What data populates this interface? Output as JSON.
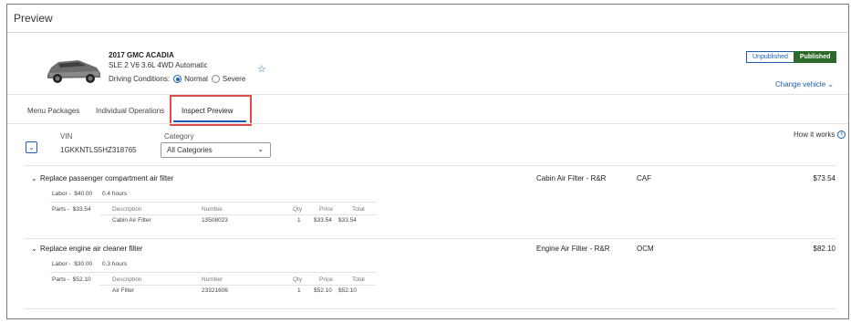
{
  "page": {
    "title": "Preview"
  },
  "vehicle": {
    "title": "2017 GMC ACADIA",
    "subtitle": "SLE 2 V6 3.6L 4WD Automatic",
    "driving_label": "Driving Conditions:",
    "normal": "Normal",
    "severe": "Severe",
    "selected_condition": "Normal"
  },
  "publish": {
    "unpublished": "Unpublished",
    "published": "Published",
    "active": "Published"
  },
  "change_vehicle": "Change vehicle",
  "tabs": [
    {
      "label": "Menu Packages"
    },
    {
      "label": "Individual Operations"
    },
    {
      "label": "Inspect Preview",
      "active": true
    }
  ],
  "vin": {
    "label": "VIN",
    "value": "1GKKNTLS5HZ318765"
  },
  "category": {
    "label": "Category",
    "value": "All Categories"
  },
  "how_it_works": "How it works",
  "parts_headers": {
    "description": "Description",
    "number": "Number",
    "qty": "Qty",
    "price": "Price",
    "total": "Total"
  },
  "services": [
    {
      "name": "Replace passenger compartment air filter",
      "operation": "Cabin Air Filter - R&R",
      "code": "CAF",
      "price": "$73.54",
      "labor_label": "Labor -",
      "labor_amount": "$40.00",
      "labor_hours": "0.4 hours",
      "parts_label": "Parts -",
      "parts_amount": "$33.54",
      "parts": [
        {
          "description": "Cabin Air Filter",
          "number": "13508023",
          "qty": "1",
          "price": "$33.54",
          "total": "$33.54"
        }
      ]
    },
    {
      "name": "Replace engine air cleaner filter",
      "operation": "Engine Air Filter - R&R",
      "code": "OCM",
      "price": "$82.10",
      "labor_label": "Labor -",
      "labor_amount": "$30.00",
      "labor_hours": "0.3 hours",
      "parts_label": "Parts -",
      "parts_amount": "$52.10",
      "parts": [
        {
          "description": "Air Filter",
          "number": "23321606",
          "qty": "1",
          "price": "$52.10",
          "total": "$52.10"
        }
      ]
    }
  ],
  "colors": {
    "accent": "#1a5fb4",
    "published": "#2d6b2d",
    "highlight": "#e34b4b"
  }
}
